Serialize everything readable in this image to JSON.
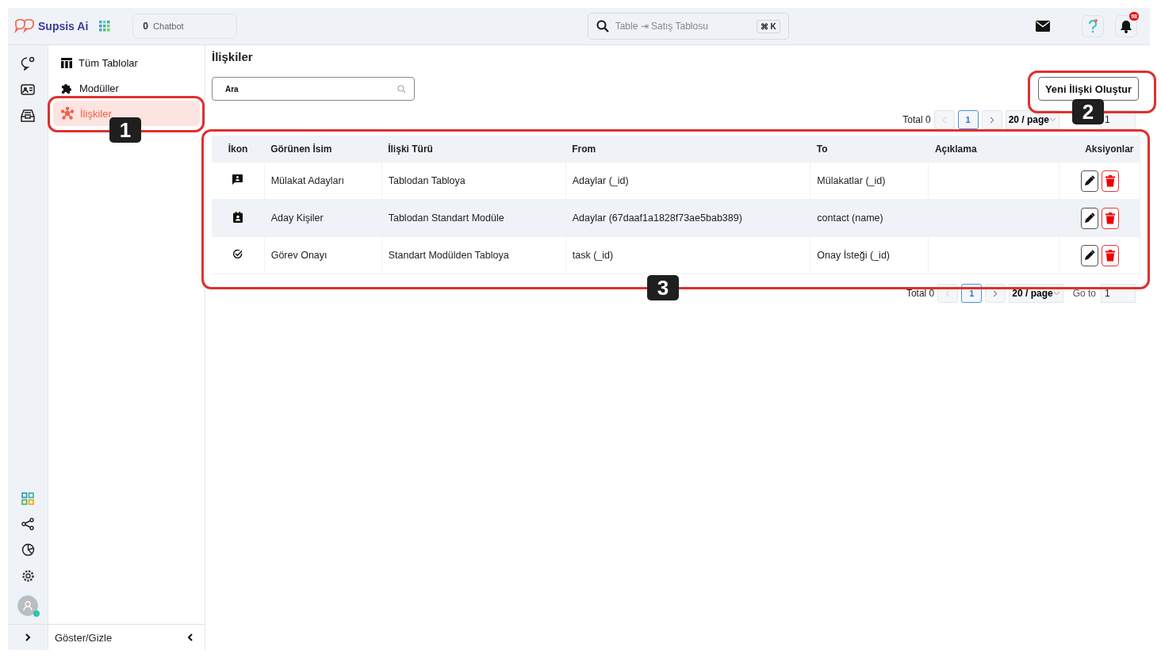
{
  "brand": "Supsis Ai",
  "chatbot": {
    "count": "0",
    "label": "Chatbot"
  },
  "search": {
    "placeholder": "Table ⇥ Satış Tablosu",
    "shortcut": "⌘ K"
  },
  "notifications": {
    "badge": "98"
  },
  "sidebar": {
    "items": [
      {
        "label": "Tüm Tablolar",
        "selected": false
      },
      {
        "label": "Modüller",
        "selected": false
      },
      {
        "label": "İlişkiler",
        "selected": true
      }
    ],
    "toggle": "Göster/Gizle"
  },
  "page_title": "İlişkiler",
  "filter": {
    "placeholder": "Ara"
  },
  "create_button": "Yeni İlişki Oluştur",
  "pagination_top": {
    "total": "Total 0",
    "page": "1",
    "page_size": "20 / page",
    "goto_value": "1"
  },
  "table": {
    "columns": [
      "İkon",
      "Görünen İsim",
      "İlişki Türü",
      "From",
      "To",
      "Açıklama",
      "Aksiyonlar"
    ],
    "rows": [
      {
        "name": "Mülakat Adayları",
        "type": "Tablodan Tabloya",
        "from": "Adaylar (_id)",
        "to": "Mülakatlar (_id)"
      },
      {
        "name": "Aday Kişiler",
        "type": "Tablodan Standart Modüle",
        "from": "Adaylar (67daaf1a1828f73ae5bab389)",
        "to": "contact (name)"
      },
      {
        "name": "Görev Onayı",
        "type": "Standart Modülden Tabloya",
        "from": "task (_id)",
        "to": "Onay İsteği (_id)"
      }
    ]
  },
  "pagination_bottom": {
    "total": "Total 0",
    "page": "1",
    "page_size": "20 / page",
    "goto_label": "Go to",
    "goto_value": "1"
  },
  "annotations": [
    "1",
    "2",
    "3"
  ]
}
